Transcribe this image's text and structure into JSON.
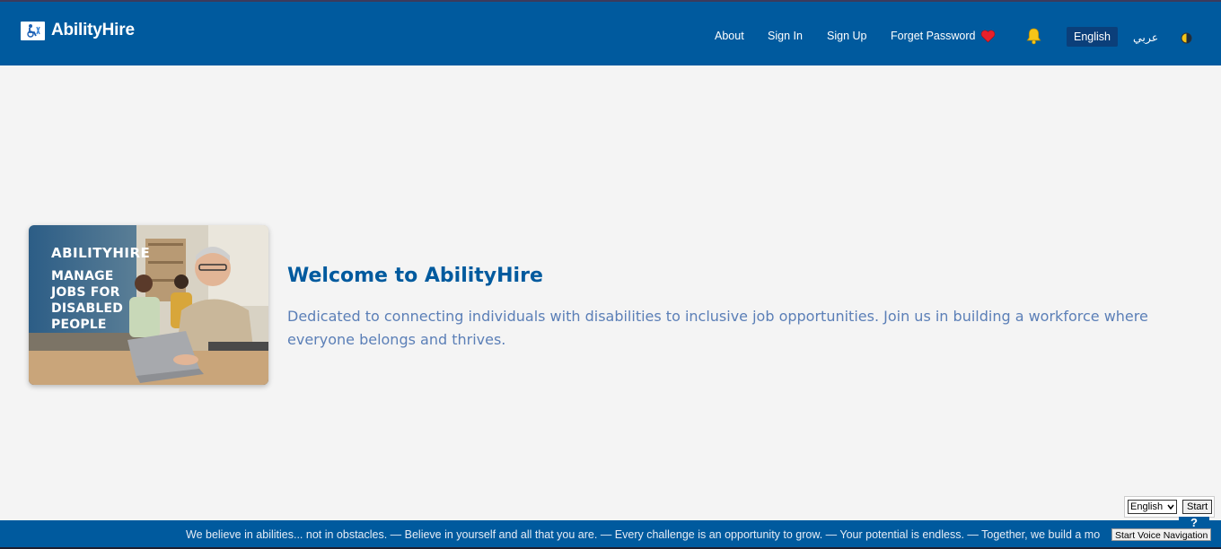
{
  "header": {
    "brand_name": "AbilityHire",
    "nav": {
      "about": "About",
      "sign_in": "Sign In",
      "sign_up": "Sign Up",
      "forget_password": "Forget Password"
    },
    "lang_english": "English",
    "lang_arabic": "عربي",
    "icons": [
      "heart-icon",
      "bell-icon",
      "theme-toggle-icon"
    ]
  },
  "hero": {
    "image_caption_line1": "ABILITYHIRE",
    "image_caption_line2": "MANAGE",
    "image_caption_line3": "JOBS FOR",
    "image_caption_line4": "DISABLED",
    "image_caption_line5": "PEOPLE",
    "title": "Welcome to AbilityHire",
    "description": "Dedicated to connecting individuals with disabilities to inclusive job opportunities. Join us in building a workforce where everyone belongs and thrives."
  },
  "footer": {
    "marquee": "We believe in abilities... not in obstacles. — Believe in yourself and all that you are. — Every challenge is an opportunity to grow. — Your potential is endless. — Together, we build a mo"
  },
  "voice": {
    "language_selected": "English",
    "start_label": "Start",
    "help_label": "?",
    "voice_nav_label": "Start Voice Navigation"
  },
  "colors": {
    "primary": "#005a9e",
    "background": "#f4f4f4",
    "description_text": "#5b7fb7"
  }
}
